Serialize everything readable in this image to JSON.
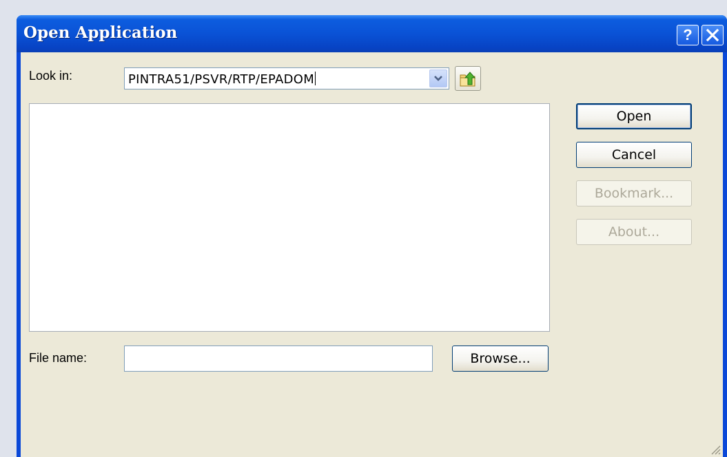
{
  "window": {
    "title": "Open Application",
    "help_label": "?",
    "close_label": "✕"
  },
  "look_in": {
    "label": "Look in:",
    "value": "PINTRA51/PSVR/RTP/EPADOM"
  },
  "file_name": {
    "label": "File name:",
    "value": "",
    "placeholder": ""
  },
  "buttons": {
    "open": "Open",
    "cancel": "Cancel",
    "bookmark": "Bookmark...",
    "about": "About...",
    "browse": "Browse..."
  },
  "icons": {
    "dropdown": "chevron-down-icon",
    "up_folder": "folder-up-icon",
    "resize": "resize-grip-icon"
  },
  "colors": {
    "titlebar": "#0a52d6",
    "dialog_bg": "#ece9d8",
    "button_border": "#003c74",
    "disabled_text": "#aca899"
  }
}
